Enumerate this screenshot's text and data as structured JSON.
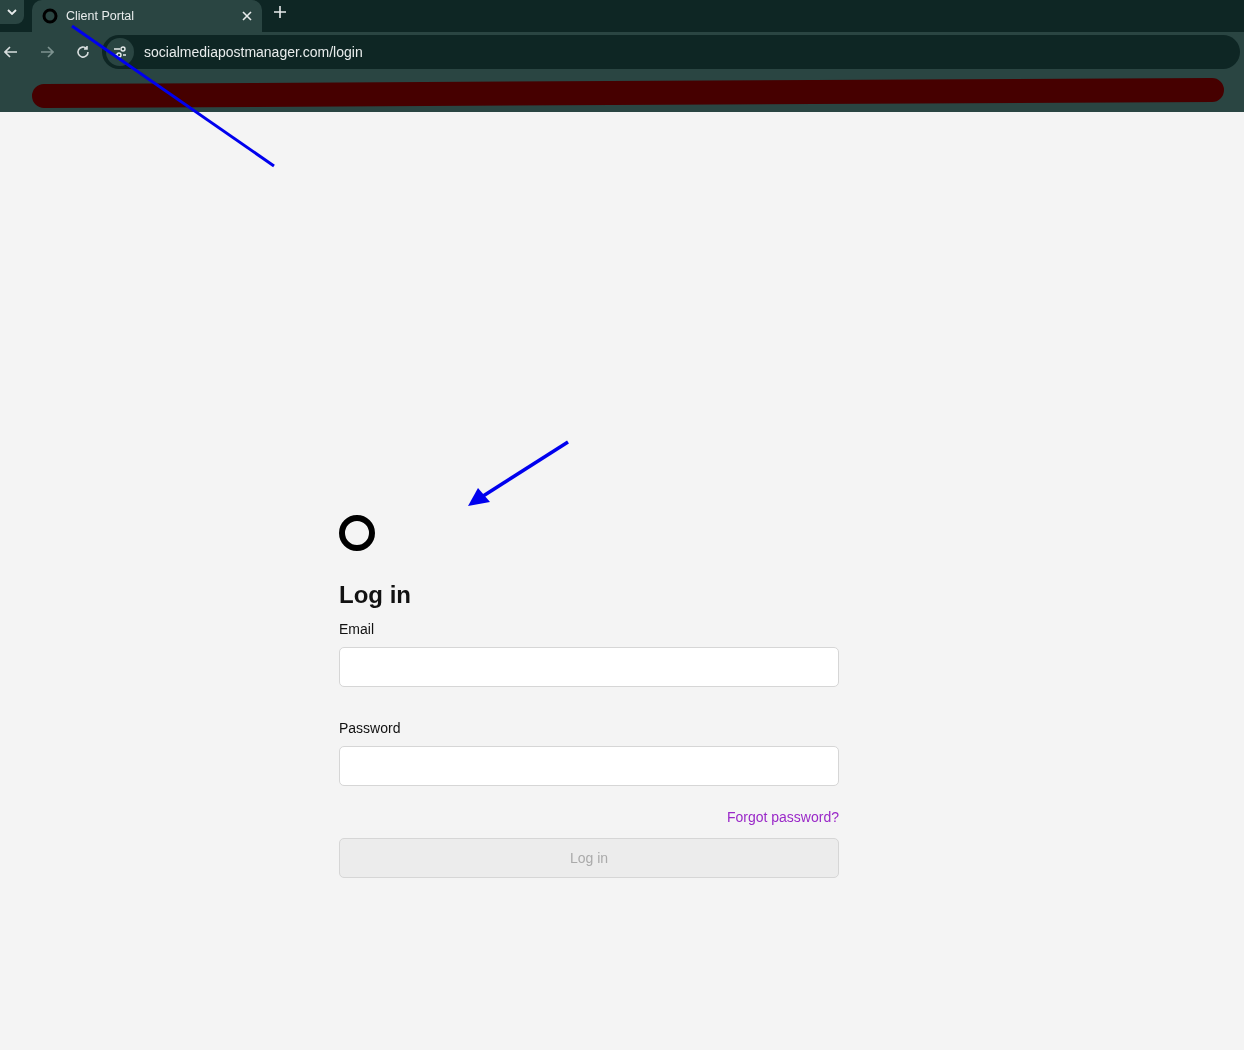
{
  "browser": {
    "tabs": [
      {
        "title": "Client Portal",
        "selected": true
      }
    ],
    "address": "socialmediapostmanager.com/login"
  },
  "login": {
    "title": "Log in",
    "fields": [
      {
        "label": "Email"
      },
      {
        "label": "Password"
      }
    ],
    "forgot_link": "Forgot password?",
    "submit": {
      "label": "Log in",
      "disabled": true
    }
  }
}
